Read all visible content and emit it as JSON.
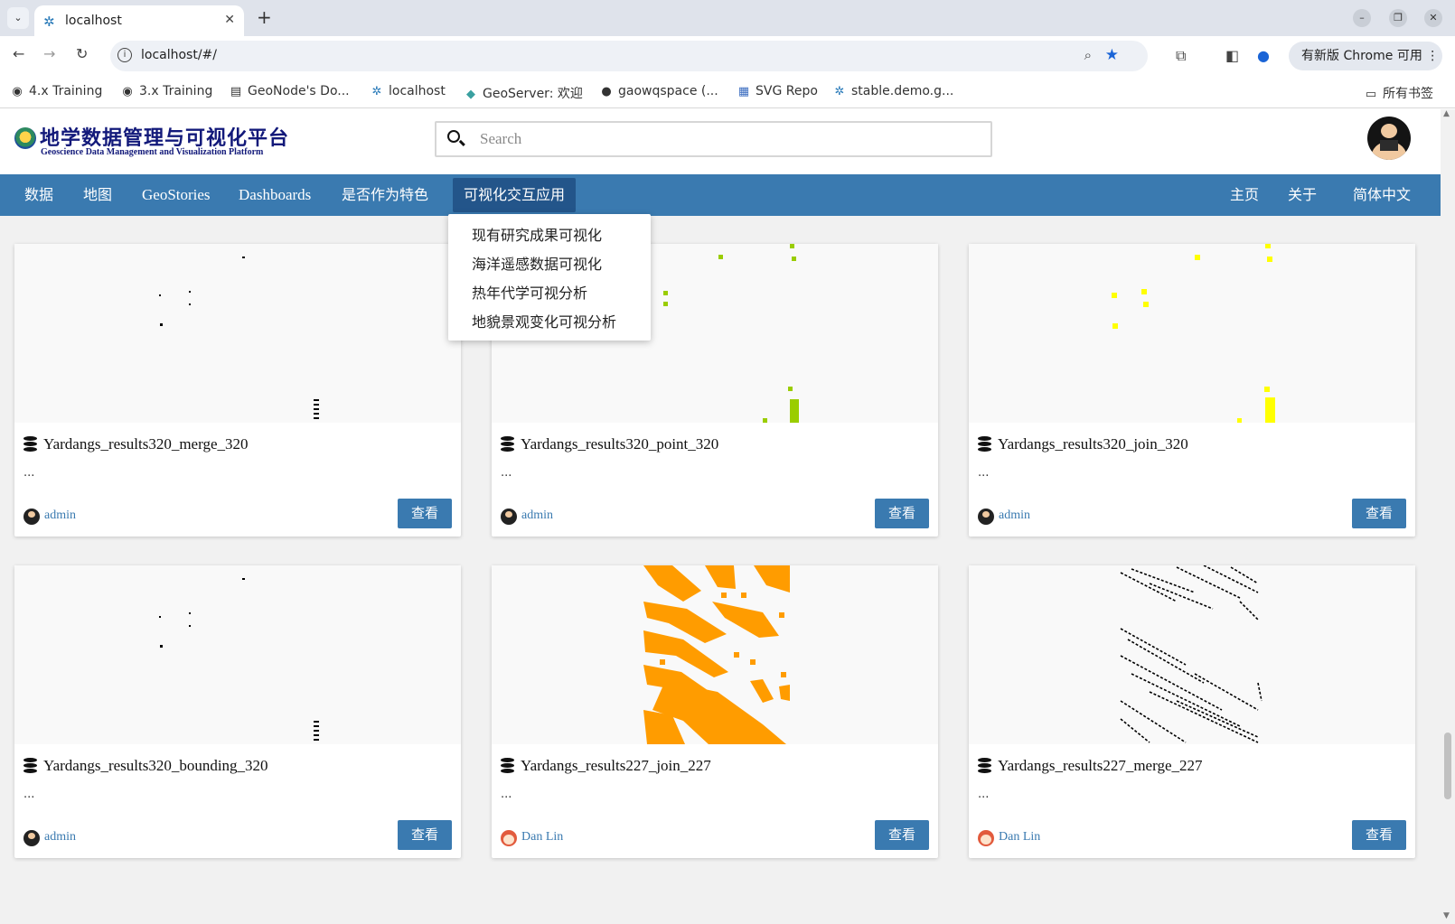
{
  "browser": {
    "tab_title": "localhost",
    "url": "localhost/#/",
    "upgrade_label": "有新版 Chrome 可用",
    "bookmarks": [
      "4.x Training",
      "3.x Training",
      "GeoNode's Do...",
      "localhost",
      "GeoServer: 欢迎",
      "gaowqspace (...",
      "SVG Repo",
      "stable.demo.g..."
    ],
    "bookmarks_folder": "所有书签"
  },
  "site": {
    "logo_cn": "地学数据管理与可视化平台",
    "logo_en": "Geoscience Data Management and Visualization Platform",
    "search_placeholder": "Search"
  },
  "nav": {
    "left": [
      "数据",
      "地图",
      "GeoStories",
      "Dashboards",
      "是否作为特色",
      "可视化交互应用"
    ],
    "right": [
      "主页",
      "关于",
      "简体中文"
    ]
  },
  "dropdown": [
    "现有研究成果可视化",
    "海洋遥感数据可视化",
    "热年代学可视分析",
    "地貌景观变化可视分析"
  ],
  "cards": [
    {
      "title": "Yardangs_results320_merge_320",
      "desc": "...",
      "owner": "admin",
      "button": "查看"
    },
    {
      "title": "Yardangs_results320_point_320",
      "desc": "...",
      "owner": "admin",
      "button": "查看"
    },
    {
      "title": "Yardangs_results320_join_320",
      "desc": "...",
      "owner": "admin",
      "button": "查看"
    },
    {
      "title": "Yardangs_results320_bounding_320",
      "desc": "...",
      "owner": "admin",
      "button": "查看"
    },
    {
      "title": "Yardangs_results227_join_227",
      "desc": "...",
      "owner": "Dan Lin",
      "button": "查看"
    },
    {
      "title": "Yardangs_results227_merge_227",
      "desc": "...",
      "owner": "Dan Lin",
      "button": "查看"
    }
  ],
  "colors": {
    "primary": "#3a7ab0",
    "orange": "#ff9c00",
    "yellow": "#ffff00",
    "green": "#9acd00"
  }
}
